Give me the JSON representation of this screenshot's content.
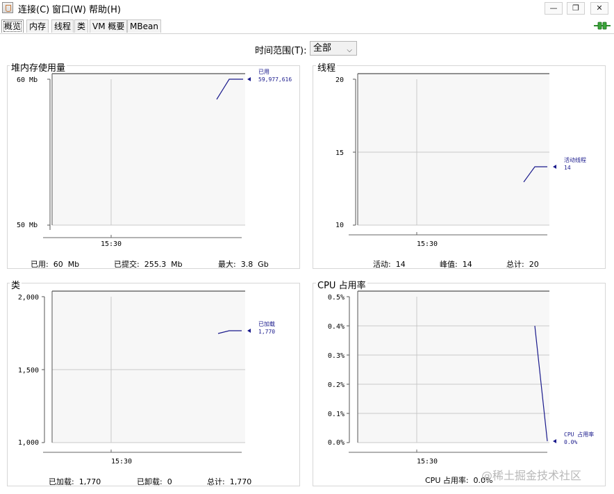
{
  "menubar": {
    "connect": "连接(C)",
    "window": "窗口(W)",
    "help": "帮助(H)",
    "minimize": "—",
    "restore": "❐",
    "close": "✕"
  },
  "tabs": [
    "概览",
    "内存",
    "线程",
    "类",
    "VM 概要",
    "MBean"
  ],
  "time_range": {
    "label": "时间范围(T):",
    "value": "全部"
  },
  "panels": {
    "heap": {
      "title": "堆内存使用量",
      "yticks": [
        "60 Mb",
        "50 Mb"
      ],
      "xtick": "15:30",
      "legend_name": "已用",
      "legend_value": "59,977,616",
      "stats": {
        "used": "已用:  60  Mb",
        "committed": "已提交:  255.3  Mb",
        "max": "最大:  3.8  Gb"
      }
    },
    "threads": {
      "title": "线程",
      "yticks": [
        "20",
        "15",
        "10"
      ],
      "xtick": "15:30",
      "legend_name": "活动线程",
      "legend_value": "14",
      "stats": {
        "live": "活动:  14",
        "peak": "峰值:  14",
        "total": "总计:  20"
      }
    },
    "classes": {
      "title": "类",
      "yticks": [
        "2,000",
        "1,500",
        "1,000"
      ],
      "xtick": "15:30",
      "legend_name": "已加载",
      "legend_value": "1,770",
      "stats": {
        "loaded": "已加载:  1,770",
        "unloaded": "已卸载:  0",
        "total": "总计:  1,770"
      }
    },
    "cpu": {
      "title": "CPU 占用率",
      "yticks": [
        "0.5%",
        "0.4%",
        "0.3%",
        "0.2%",
        "0.1%",
        "0.0%"
      ],
      "xtick": "15:30",
      "legend_name": "CPU 占用率",
      "legend_value": "0.0%",
      "stats": {
        "usage": "CPU 占用率:  0.0%"
      }
    }
  },
  "chart_data": [
    {
      "type": "line",
      "title": "堆内存使用量",
      "ylim": [
        50,
        60
      ],
      "unit": "Mb",
      "series": [
        {
          "name": "已用",
          "values": [
            58.6,
            60,
            60
          ]
        }
      ]
    },
    {
      "type": "line",
      "title": "线程",
      "ylim": [
        10,
        20
      ],
      "series": [
        {
          "name": "活动线程",
          "values": [
            13,
            14,
            14
          ]
        }
      ]
    },
    {
      "type": "line",
      "title": "类",
      "ylim": [
        1000,
        2000
      ],
      "series": [
        {
          "name": "已加载",
          "values": [
            1755,
            1770,
            1770
          ]
        }
      ]
    },
    {
      "type": "line",
      "title": "CPU 占用率",
      "ylim": [
        0,
        0.5
      ],
      "unit": "%",
      "series": [
        {
          "name": "CPU 占用率",
          "values": [
            0.4,
            0.0
          ]
        }
      ]
    }
  ],
  "watermark": "@稀土掘金技术社区",
  "colors": {
    "series": "#1a1a8c",
    "grid": "#c8c8c8",
    "plot_bg": "#f7f7f7"
  }
}
